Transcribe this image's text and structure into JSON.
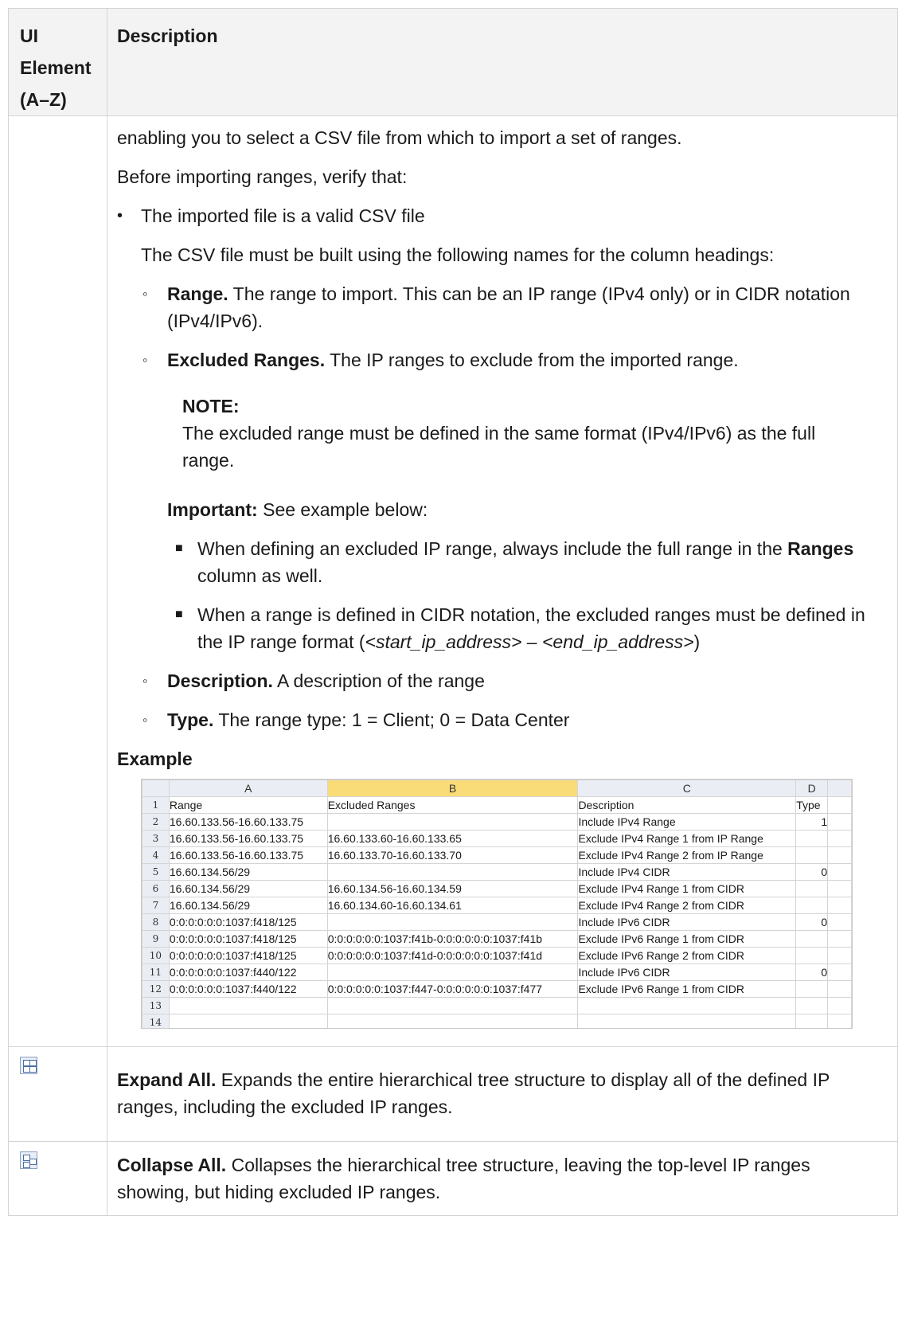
{
  "header": {
    "col1": "UI Element (A–Z)",
    "col2": "Description"
  },
  "intro": {
    "line1": "enabling you to select a CSV file from which to import a set of ranges.",
    "line2": "Before importing ranges, verify that:"
  },
  "bullet": {
    "marker": "•",
    "text": "The imported file is a valid CSV file",
    "desc": "The CSV file must be built using the following names for the column headings:"
  },
  "columns_list": {
    "marker": "◦",
    "range_label": "Range.",
    "range_text": "The range to import. This can be an IP range (IPv4 only) or in CIDR notation (IPv4/IPv6).",
    "excluded_label": "Excluded Ranges.",
    "excluded_text": "The IP ranges to exclude from the imported range.",
    "note_title": "NOTE:",
    "note_text": "The excluded range must be defined in the same format (IPv4/IPv6) as the full range.",
    "important_label": "Important:",
    "important_text": "See example below:",
    "sub_marker": "■",
    "sub1_a": "When defining an excluded IP range, always include the full range in the",
    "sub1_b": "Ranges",
    "sub1_c": "column as well.",
    "sub2_a": "When a range is defined in CIDR notation, the excluded ranges must be defined in the IP range format (",
    "sub2_b": "<start_ip_address> – <end_ip_address>",
    "sub2_c": ")",
    "desc_label": "Description.",
    "desc_text": "A description of the range",
    "type_label": "Type.",
    "type_text": "The range type: 1 = Client; 0 = Data Center"
  },
  "example_title": "Example",
  "spreadsheet": {
    "columns": [
      "A",
      "B",
      "C",
      "D"
    ],
    "rows": [
      [
        "1",
        "Range",
        "Excluded Ranges",
        "Description",
        "Type"
      ],
      [
        "2",
        "16.60.133.56-16.60.133.75",
        "",
        "Include IPv4 Range",
        "1"
      ],
      [
        "3",
        "16.60.133.56-16.60.133.75",
        "16.60.133.60-16.60.133.65",
        "Exclude IPv4 Range 1 from IP Range",
        ""
      ],
      [
        "4",
        "16.60.133.56-16.60.133.75",
        "16.60.133.70-16.60.133.70",
        "Exclude IPv4 Range 2 from IP Range",
        ""
      ],
      [
        "5",
        "16.60.134.56/29",
        "",
        "Include IPv4 CIDR",
        "0"
      ],
      [
        "6",
        "16.60.134.56/29",
        "16.60.134.56-16.60.134.59",
        "Exclude IPv4 Range 1 from CIDR",
        ""
      ],
      [
        "7",
        "16.60.134.56/29",
        "16.60.134.60-16.60.134.61",
        "Exclude IPv4 Range 2 from CIDR",
        ""
      ],
      [
        "8",
        "0:0:0:0:0:0:1037:f418/125",
        "",
        "Include IPv6 CIDR",
        "0"
      ],
      [
        "9",
        "0:0:0:0:0:0:1037:f418/125",
        "0:0:0:0:0:0:1037:f41b-0:0:0:0:0:0:1037:f41b",
        "Exclude IPv6 Range 1 from CIDR",
        ""
      ],
      [
        "10",
        "0:0:0:0:0:0:1037:f418/125",
        "0:0:0:0:0:0:1037:f41d-0:0:0:0:0:0:1037:f41d",
        "Exclude IPv6 Range 2 from CIDR",
        ""
      ],
      [
        "11",
        "0:0:0:0:0:0:1037:f440/122",
        "",
        "Include IPv6 CIDR",
        "0"
      ],
      [
        "12",
        "0:0:0:0:0:0:1037:f440/122",
        "0:0:0:0:0:0:1037:f447-0:0:0:0:0:0:1037:f477",
        "Exclude IPv6 Range 1 from CIDR",
        ""
      ],
      [
        "13",
        "",
        "",
        "",
        ""
      ],
      [
        "14",
        "",
        "",
        "",
        ""
      ]
    ]
  },
  "rows": {
    "expand_icon": "expand-all-icon",
    "expand_label": "Expand All.",
    "expand_text": "Expands the entire hierarchical tree structure to display all of the defined IP ranges, including the excluded IP ranges.",
    "collapse_icon": "collapse-all-icon",
    "collapse_label": "Collapse All.",
    "collapse_text": "Collapses the hierarchical tree structure, leaving the top-level IP ranges showing, but hiding excluded IP ranges."
  }
}
